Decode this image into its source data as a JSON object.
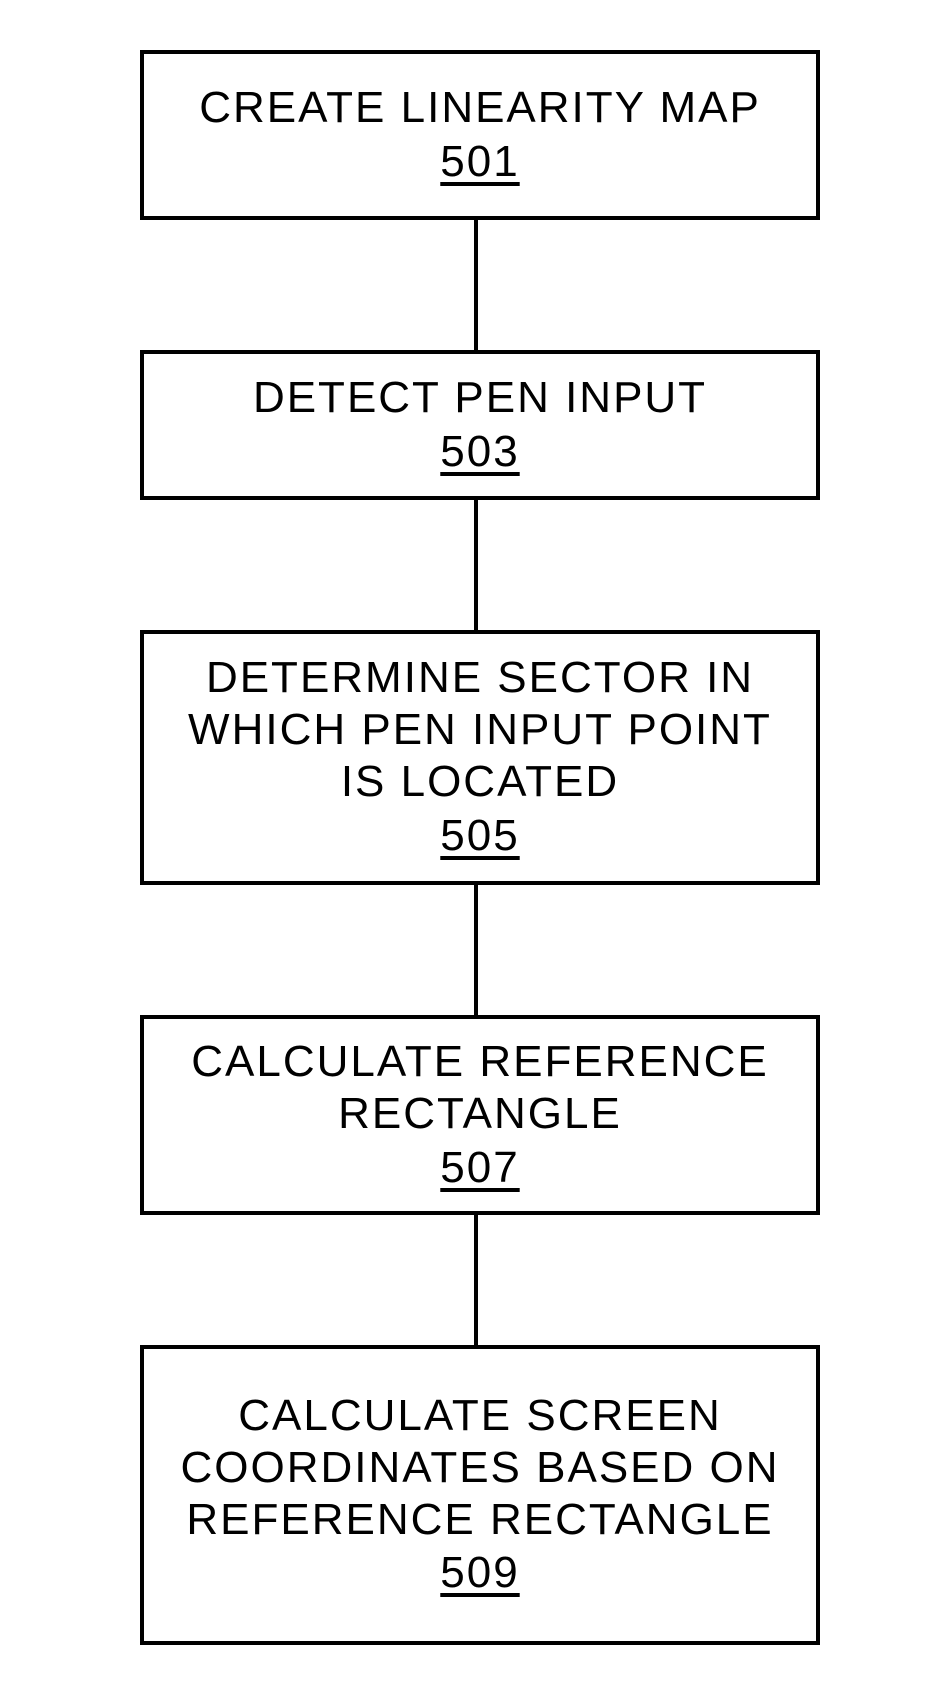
{
  "flow": {
    "steps": [
      {
        "label": "CREATE LINEARITY MAP",
        "ref": "501"
      },
      {
        "label": "DETECT PEN INPUT",
        "ref": "503"
      },
      {
        "label": "DETERMINE SECTOR IN WHICH PEN INPUT POINT IS LOCATED",
        "ref": "505"
      },
      {
        "label": "CALCULATE REFERENCE RECTANGLE",
        "ref": "507"
      },
      {
        "label": "CALCULATE SCREEN COORDINATES BASED ON REFERENCE RECTANGLE",
        "ref": "509"
      }
    ]
  }
}
